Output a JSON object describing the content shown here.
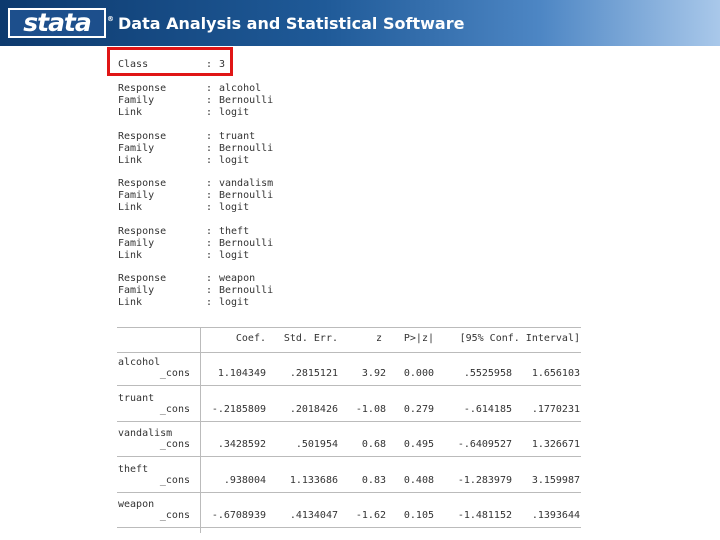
{
  "header": {
    "logo_text": "stata",
    "logo_mark": "®",
    "tagline": "Data Analysis and Statistical Software"
  },
  "class_line": {
    "label": "Class",
    "sep": ":",
    "value": "3"
  },
  "responses": [
    {
      "response": "alcohol",
      "family": "Bernoulli",
      "link": "logit"
    },
    {
      "response": "truant",
      "family": "Bernoulli",
      "link": "logit"
    },
    {
      "response": "vandalism",
      "family": "Bernoulli",
      "link": "logit"
    },
    {
      "response": "theft",
      "family": "Bernoulli",
      "link": "logit"
    },
    {
      "response": "weapon",
      "family": "Bernoulli",
      "link": "logit"
    }
  ],
  "field_labels": {
    "response": "Response",
    "family": "Family",
    "link": "Link",
    "sep": ":"
  },
  "table": {
    "headers": {
      "coef": "Coef.",
      "se": "Std. Err.",
      "z": "z",
      "p": "P>|z|",
      "ci": "[95% Conf. Interval]"
    },
    "rows": [
      {
        "var": "alcohol",
        "term": "_cons",
        "coef": "1.104349",
        "se": ".2815121",
        "z": "3.92",
        "p": "0.000",
        "lo": ".5525958",
        "hi": "1.656103"
      },
      {
        "var": "truant",
        "term": "_cons",
        "coef": "-.2185809",
        "se": ".2018426",
        "z": "-1.08",
        "p": "0.279",
        "lo": "-.614185",
        "hi": ".1770231"
      },
      {
        "var": "vandalism",
        "term": "_cons",
        "coef": ".3428592",
        "se": ".501954",
        "z": "0.68",
        "p": "0.495",
        "lo": "-.6409527",
        "hi": "1.326671"
      },
      {
        "var": "theft",
        "term": "_cons",
        "coef": ".938004",
        "se": "1.133686",
        "z": "0.83",
        "p": "0.408",
        "lo": "-1.283979",
        "hi": "3.159987"
      },
      {
        "var": "weapon",
        "term": "_cons",
        "coef": "-.6708939",
        "se": ".4134047",
        "z": "-1.62",
        "p": "0.105",
        "lo": "-1.481152",
        "hi": ".1393644"
      }
    ]
  },
  "colors": {
    "highlight": "#e01616",
    "banner_dark": "#0d3a6e",
    "banner_light": "#a9c8ea"
  }
}
